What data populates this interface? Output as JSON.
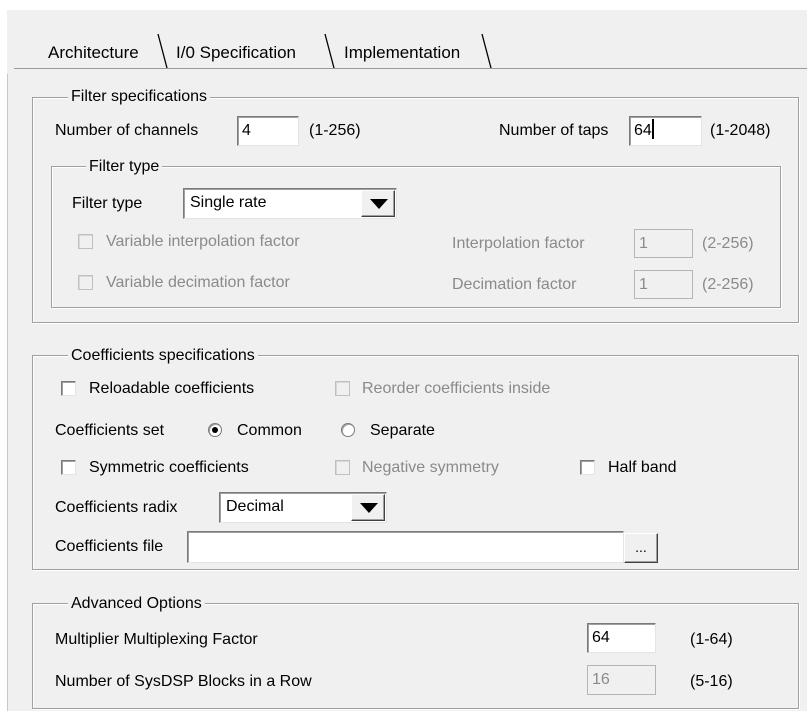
{
  "tabs": [
    {
      "label": "Architecture",
      "active": true
    },
    {
      "label": "I/0 Specification",
      "active": false
    },
    {
      "label": "Implementation",
      "active": false
    }
  ],
  "filter_specs": {
    "legend": "Filter specifications",
    "channels_label": "Number of channels",
    "channels_value": "4",
    "channels_range": "(1-256)",
    "taps_label": "Number of taps",
    "taps_value": "64",
    "taps_range": "(1-2048)",
    "filter_type_group": {
      "legend": "Filter type",
      "type_label": "Filter type",
      "type_value": "Single rate",
      "var_interp_label": "Variable interpolation factor",
      "var_decim_label": "Variable decimation factor",
      "interp_label": "Interpolation factor",
      "interp_value": "1",
      "interp_range": "(2-256)",
      "decim_label": "Decimation factor",
      "decim_value": "1",
      "decim_range": "(2-256)"
    }
  },
  "coeff_specs": {
    "legend": "Coefficients specifications",
    "reloadable_label": "Reloadable coefficients",
    "reorder_label": "Reorder coefficients inside",
    "set_label": "Coefficients set",
    "set_common": "Common",
    "set_separate": "Separate",
    "set_selected": "Common",
    "symmetric_label": "Symmetric coefficients",
    "negative_label": "Negative symmetry",
    "halfband_label": "Half band",
    "radix_label": "Coefficients radix",
    "radix_value": "Decimal",
    "file_label": "Coefficients file",
    "file_value": "",
    "browse_label": "..."
  },
  "advanced": {
    "legend": "Advanced Options",
    "mux_label": "Multiplier Multiplexing Factor",
    "mux_value": "64",
    "mux_range": "(1-64)",
    "sysdsp_label": "Number of SysDSP Blocks in a Row",
    "sysdsp_value": "16",
    "sysdsp_range": "(5-16)"
  }
}
